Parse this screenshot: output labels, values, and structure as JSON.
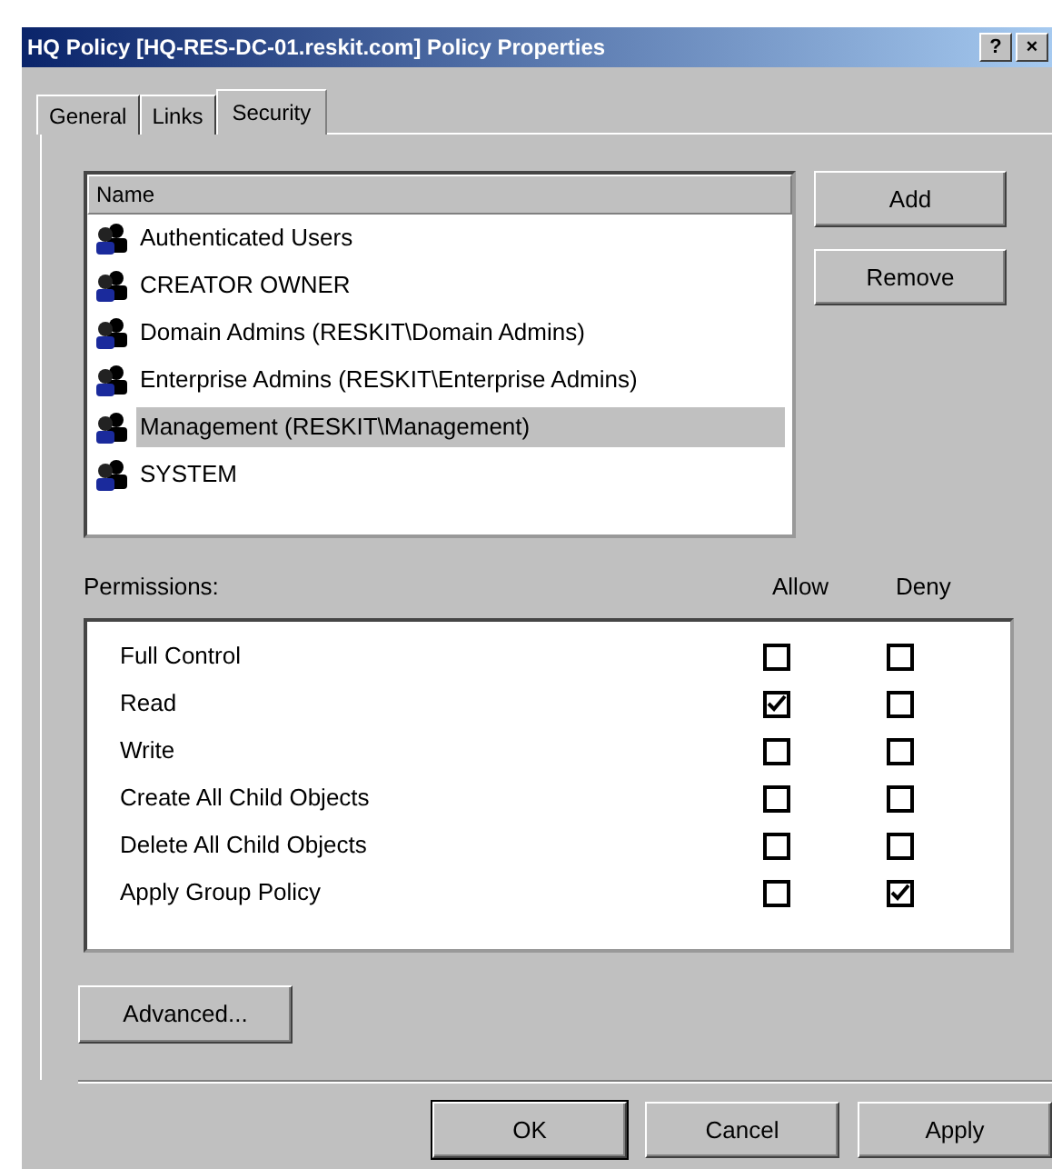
{
  "window": {
    "title": "HQ Policy [HQ-RES-DC-01.reskit.com] Policy Properties",
    "help": "?",
    "close": "×"
  },
  "tabs": [
    {
      "label": "General",
      "selected": false
    },
    {
      "label": "Links",
      "selected": false
    },
    {
      "label": "Security",
      "selected": true
    }
  ],
  "names": {
    "header": "Name",
    "items": [
      {
        "label": "Authenticated Users",
        "selected": false
      },
      {
        "label": "CREATOR OWNER",
        "selected": false
      },
      {
        "label": "Domain Admins (RESKIT\\Domain Admins)",
        "selected": false
      },
      {
        "label": "Enterprise Admins (RESKIT\\Enterprise Admins)",
        "selected": false
      },
      {
        "label": "Management (RESKIT\\Management)",
        "selected": true
      },
      {
        "label": "SYSTEM",
        "selected": false
      }
    ]
  },
  "name_buttons": [
    "Add",
    "Remove"
  ],
  "permissions": {
    "header": "Permissions:",
    "allow_header": "Allow",
    "deny_header": "Deny",
    "rows": [
      {
        "label": "Full Control",
        "allow": false,
        "deny": false
      },
      {
        "label": "Read",
        "allow": true,
        "deny": false
      },
      {
        "label": "Write",
        "allow": false,
        "deny": false
      },
      {
        "label": "Create All Child Objects",
        "allow": false,
        "deny": false
      },
      {
        "label": "Delete All Child Objects",
        "allow": false,
        "deny": false
      },
      {
        "label": "Apply Group Policy",
        "allow": false,
        "deny": true
      }
    ]
  },
  "advanced_button": "Advanced...",
  "dialog_buttons": [
    "OK",
    "Cancel",
    "Apply"
  ]
}
